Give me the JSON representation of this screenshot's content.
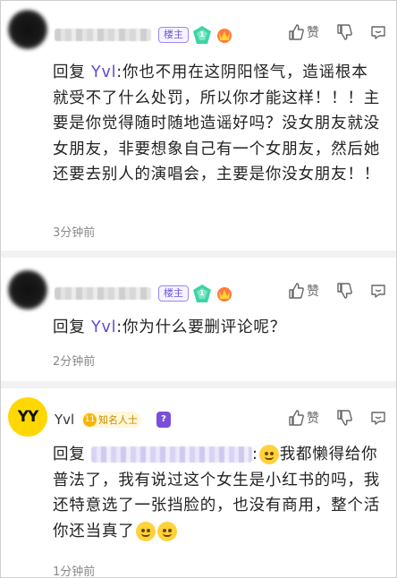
{
  "comments": [
    {
      "floor_badge": "楼主",
      "level": "1",
      "actions": {
        "like_label": "赞"
      },
      "reply_prefix": "回复",
      "reply_to": "Yvl",
      "text": ":你也不用在这阴阳怪气，造谣根本就受不了什么处罚，所以你才能这样！！！主要是你觉得随时随地造谣好吗？没女朋友就没女朋友，非要想象自己有一个女朋友，然后她还要去别人的演唱会，主要是你没女朋友！！",
      "time": "3分钟前"
    },
    {
      "floor_badge": "楼主",
      "level": "1",
      "actions": {
        "like_label": "赞"
      },
      "reply_prefix": "回复",
      "reply_to": "Yvl",
      "text": ":你为什么要删评论呢？",
      "time": "2分钟前"
    },
    {
      "username": "Yvl",
      "avatar_text": "YY",
      "known_badge": {
        "level": "11",
        "label": "知名人士"
      },
      "purple_badge": "?",
      "actions": {
        "like_label": "赞"
      },
      "reply_prefix": "回复",
      "text_after": "我都懒得给你普法了，我有说过这个女生是小红书的吗，我还特意选了一张挡脸的，也没有商用，整个活你还当真了",
      "time": "1分钟前"
    }
  ],
  "icons": [
    "thumbs-up-icon",
    "thumbs-down-icon",
    "comment-icon",
    "gem-icon",
    "crown-icon",
    "smile-emoji",
    "blush-emoji"
  ],
  "colors": {
    "reply_name": "#5c4ad6",
    "badge_border": "#9d86f0",
    "yy_avatar": "#ffd803",
    "known_badge": "#f5b400"
  }
}
